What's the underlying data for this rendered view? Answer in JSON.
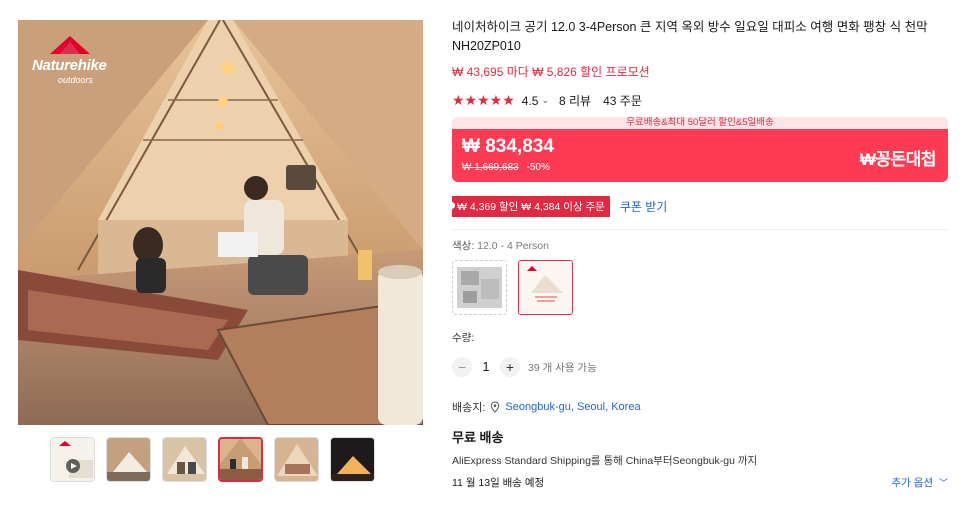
{
  "gallery": {
    "logo_brand": "Naturehike",
    "logo_sub": "outdoors"
  },
  "product": {
    "title": "네이처하이크 공기 12.0 3-4Person 큰 지역 옥외 방수 일요일 대피소 여행 면화 팽창 식 천막 NH20ZP010",
    "promo": "₩ 43,695 마다 ₩ 5,826 할인 프로모션",
    "rating": {
      "stars": "★★★★★",
      "score": "4.5",
      "reviews": "8 리뷰",
      "orders": "43 주문"
    }
  },
  "banner": {
    "top": "무료배송&최대 50달러 할인&5일배송",
    "price": "₩ 834,834",
    "old_price": "₩ 1,669,683",
    "discount": "-50%",
    "deal": "₩꽁돈대첩"
  },
  "coupon": {
    "tag": "₩ 4,369 할인 ₩ 4,384 이상 주문",
    "link": "쿠폰 받기"
  },
  "options": {
    "color_label": "색상:",
    "color_value": "12.0 - 4 Person"
  },
  "quantity": {
    "label": "수량:",
    "minus": "−",
    "value": "1",
    "plus": "+",
    "available": "39 개 사용 가능"
  },
  "shipping": {
    "to_label": "배송지:",
    "location": "Seongbuk-gu, Seoul, Korea",
    "free": "무료 배송",
    "detail": "AliExpress Standard Shipping를 통해 China부터Seongbuk-gu 까지",
    "eta": "11 월 13일 배송 예정",
    "more": "추가 옵션"
  },
  "colors": {
    "accent": "#e02a41",
    "link": "#2266cc"
  }
}
